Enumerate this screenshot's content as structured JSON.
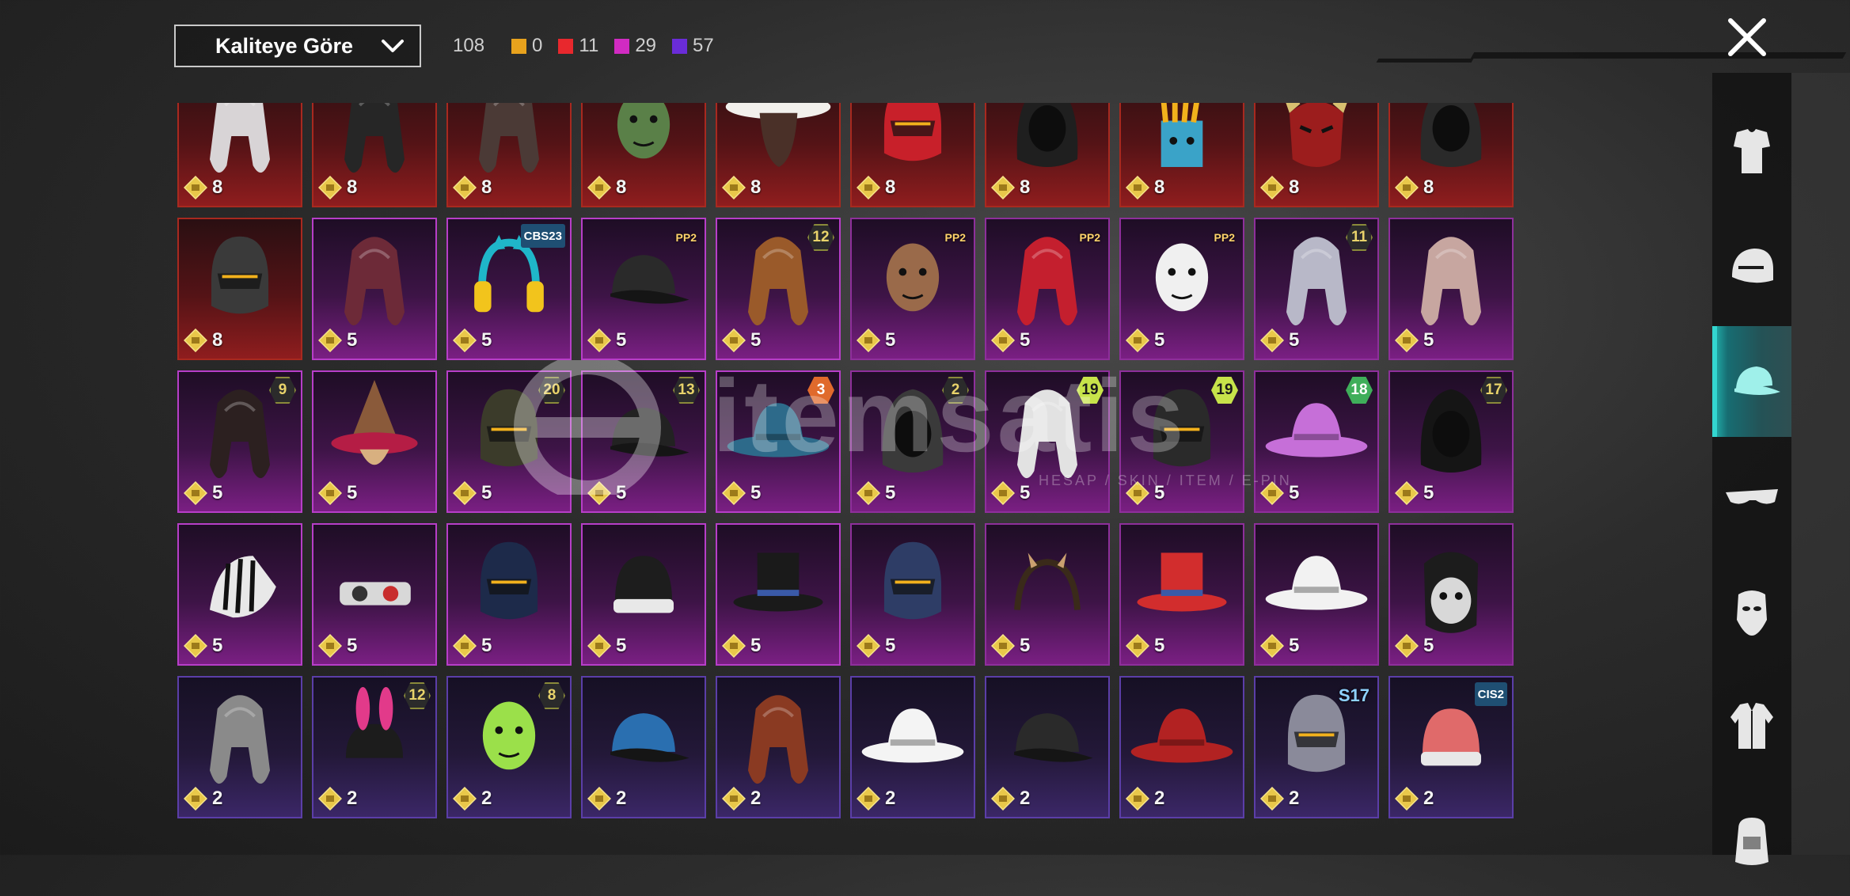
{
  "header": {
    "sort_label": "Kaliteye Göre",
    "total_count": "108",
    "quality_counts": [
      {
        "color": "#e8a21d",
        "value": "0"
      },
      {
        "color": "#e8282d",
        "value": "11"
      },
      {
        "color": "#d12bc2",
        "value": "29"
      },
      {
        "color": "#6a2cd8",
        "value": "57"
      }
    ]
  },
  "watermark": {
    "brand": "itemsatis",
    "tagline": "HESAP / SKIN / ITEM / E-PIN"
  },
  "sidebar": {
    "categories": [
      {
        "icon": "outfit-icon",
        "active": false
      },
      {
        "icon": "helmet-icon",
        "active": false
      },
      {
        "icon": "cap-icon",
        "active": true
      },
      {
        "icon": "glasses-icon",
        "active": false
      },
      {
        "icon": "mask-icon",
        "active": false
      },
      {
        "icon": "jacket-icon",
        "active": false
      },
      {
        "icon": "bag-icon",
        "active": false
      }
    ]
  },
  "items": [
    {
      "quality": "q8",
      "cost": "8",
      "badge": "",
      "art": "hair-white",
      "hue": "#d8d4d6"
    },
    {
      "quality": "q8",
      "cost": "8",
      "badge": "",
      "art": "hair-dark",
      "hue": "#262626"
    },
    {
      "quality": "q8",
      "cost": "8",
      "badge": "",
      "art": "hair-braid",
      "hue": "#4b3a36"
    },
    {
      "quality": "q8",
      "cost": "8",
      "badge": "",
      "art": "face",
      "hue": "#5a8048"
    },
    {
      "quality": "q8",
      "cost": "8",
      "badge": "",
      "art": "cowboy",
      "hue": "#f2f0ec"
    },
    {
      "quality": "q8",
      "cost": "8",
      "badge": "",
      "art": "helmet",
      "hue": "#c8202a"
    },
    {
      "quality": "q8",
      "cost": "8",
      "badge": "",
      "art": "hood",
      "hue": "#1f1f1f"
    },
    {
      "quality": "q8",
      "cost": "8",
      "badge": "",
      "art": "fries",
      "hue": "#f2b11c"
    },
    {
      "quality": "q8",
      "cost": "8",
      "badge": "",
      "art": "oni",
      "hue": "#9c1d1d"
    },
    {
      "quality": "q8",
      "cost": "8",
      "badge": "",
      "art": "hood",
      "hue": "#2a2a2a"
    },
    {
      "quality": "q8",
      "cost": "8",
      "badge": "",
      "art": "helmet",
      "hue": "#3a3a3a"
    },
    {
      "quality": "q5",
      "cost": "5",
      "badge": "",
      "art": "hair-long",
      "hue": "#6d2a38"
    },
    {
      "quality": "q5",
      "cost": "5",
      "badge": "CBS23",
      "badge_style": "b-teal",
      "art": "headphones",
      "hue": "#1fb6c9"
    },
    {
      "quality": "q5",
      "cost": "5",
      "badge": "PP2",
      "badge_style": "b-ppz",
      "art": "cap",
      "hue": "#2a2a2a"
    },
    {
      "quality": "q5",
      "cost": "5",
      "badge": "12",
      "badge_style": "b-dark",
      "art": "hair-long",
      "hue": "#9a5a2a"
    },
    {
      "quality": "q5",
      "cost": "5",
      "badge": "PP2",
      "badge_style": "b-ppz",
      "art": "face",
      "hue": "#9a6a4a"
    },
    {
      "quality": "q5",
      "cost": "5",
      "badge": "PP2",
      "badge_style": "b-ppz",
      "art": "hair-long",
      "hue": "#c41f2e"
    },
    {
      "quality": "q5",
      "cost": "5",
      "badge": "PP2",
      "badge_style": "b-ppz",
      "art": "face",
      "hue": "#f0f0f0"
    },
    {
      "quality": "q5",
      "cost": "5",
      "badge": "11",
      "badge_style": "b-dark",
      "art": "hair-long",
      "hue": "#b8b8c8"
    },
    {
      "quality": "q5",
      "cost": "5",
      "badge": "",
      "art": "hair-long",
      "hue": "#c7a6a0"
    },
    {
      "quality": "q5",
      "cost": "5",
      "badge": "9",
      "badge_style": "b-dark",
      "art": "hair-long",
      "hue": "#2c2020"
    },
    {
      "quality": "q5",
      "cost": "5",
      "badge": "",
      "art": "witch",
      "hue": "#b51d45"
    },
    {
      "quality": "q5",
      "cost": "5",
      "badge": "20",
      "badge_style": "b-dark",
      "art": "helmet",
      "hue": "#3b3b2a"
    },
    {
      "quality": "q5",
      "cost": "5",
      "badge": "13",
      "badge_style": "b-dark",
      "art": "cap",
      "hue": "#222222"
    },
    {
      "quality": "q5",
      "cost": "5",
      "badge": "3",
      "badge_style": "b-orange",
      "art": "hat-wide",
      "hue": "#2d6a8a"
    },
    {
      "quality": "q5",
      "cost": "5",
      "badge": "2",
      "badge_style": "b-dark",
      "art": "hood",
      "hue": "#3a3a3a"
    },
    {
      "quality": "q5",
      "cost": "5",
      "badge": "19",
      "badge_style": "b-lime",
      "art": "hair-white",
      "hue": "#e2e2e2"
    },
    {
      "quality": "q5",
      "cost": "5",
      "badge": "19",
      "badge_style": "b-lime",
      "art": "helmet",
      "hue": "#2a2a2a"
    },
    {
      "quality": "q5",
      "cost": "5",
      "badge": "18",
      "badge_style": "b-green",
      "art": "hat-wide",
      "hue": "#c66fd8"
    },
    {
      "quality": "q5",
      "cost": "5",
      "badge": "17",
      "badge_style": "b-dark",
      "art": "hood",
      "hue": "#151515"
    },
    {
      "quality": "q5",
      "cost": "5",
      "badge": "",
      "art": "zebra",
      "hue": "#e8e8e8"
    },
    {
      "quality": "q5",
      "cost": "5",
      "badge": "",
      "art": "goggles",
      "hue": "#d8d8d8"
    },
    {
      "quality": "q5",
      "cost": "5",
      "badge": "",
      "art": "helmet",
      "hue": "#1d2a4a"
    },
    {
      "quality": "q5",
      "cost": "5",
      "badge": "",
      "art": "beanie",
      "hue": "#1d1d1d"
    },
    {
      "quality": "q5",
      "cost": "5",
      "badge": "",
      "art": "tophat",
      "hue": "#1a1a1a"
    },
    {
      "quality": "q5",
      "cost": "5",
      "badge": "",
      "art": "helmet",
      "hue": "#2e3d66"
    },
    {
      "quality": "q5",
      "cost": "5",
      "badge": "",
      "art": "headband",
      "hue": "#3a2a1a"
    },
    {
      "quality": "q5",
      "cost": "5",
      "badge": "",
      "art": "tophat",
      "hue": "#d22d2d"
    },
    {
      "quality": "q5",
      "cost": "5",
      "badge": "",
      "art": "hat-wide",
      "hue": "#f2f2f2"
    },
    {
      "quality": "q5",
      "cost": "5",
      "badge": "",
      "art": "mask",
      "hue": "#d8d8d8"
    },
    {
      "quality": "q2",
      "cost": "2",
      "badge": "",
      "art": "hair-long",
      "hue": "#8a8a8a"
    },
    {
      "quality": "q2",
      "cost": "2",
      "badge": "12",
      "badge_style": "b-dark",
      "art": "bunny",
      "hue": "#e23a8a"
    },
    {
      "quality": "q2",
      "cost": "2",
      "badge": "8",
      "badge_style": "b-dark",
      "art": "face",
      "hue": "#9be04a"
    },
    {
      "quality": "q2",
      "cost": "2",
      "badge": "",
      "art": "cap",
      "hue": "#2a6fb0"
    },
    {
      "quality": "q2",
      "cost": "2",
      "badge": "",
      "art": "hair-long",
      "hue": "#8a3a22"
    },
    {
      "quality": "q2",
      "cost": "2",
      "badge": "",
      "art": "hat-wide",
      "hue": "#f4f4f4"
    },
    {
      "quality": "q2",
      "cost": "2",
      "badge": "",
      "art": "cap",
      "hue": "#2a2a2a"
    },
    {
      "quality": "q2",
      "cost": "2",
      "badge": "",
      "art": "hat-wide",
      "hue": "#b22222"
    },
    {
      "quality": "q2",
      "cost": "2",
      "badge": "S17",
      "badge_style": "b-s17",
      "art": "helmet",
      "hue": "#8a8a9a"
    },
    {
      "quality": "q2",
      "cost": "2",
      "badge": "CIS2",
      "badge_style": "b-teal",
      "art": "beanie",
      "hue": "#e06a6a"
    }
  ]
}
